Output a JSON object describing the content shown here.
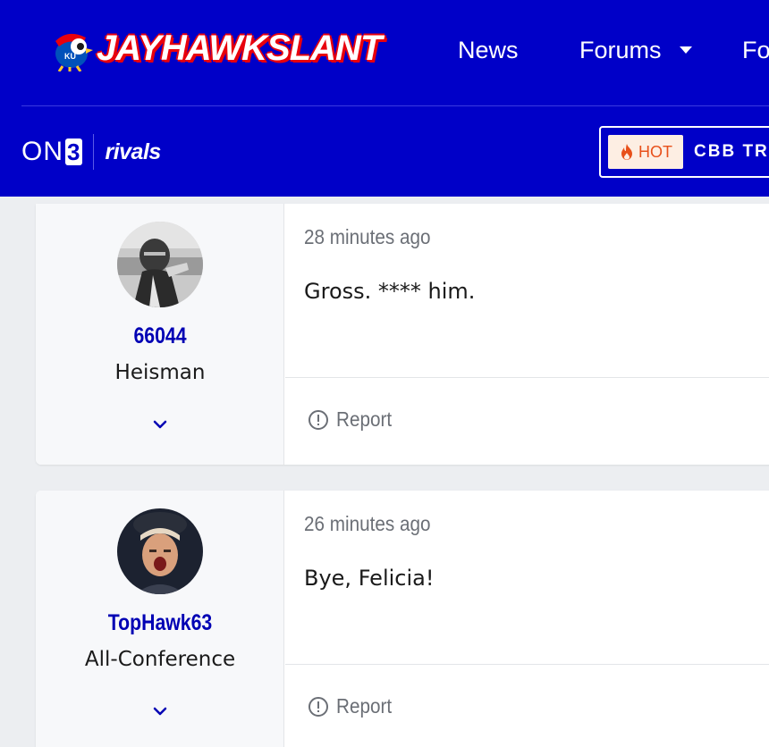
{
  "header": {
    "logo_text": "JAYHAWKSLANT",
    "nav": [
      {
        "label": "News"
      },
      {
        "label": "Forums"
      },
      {
        "label": "Fo"
      }
    ],
    "network": {
      "on": "ON",
      "three": "3",
      "rivals": "rivals"
    },
    "trending": {
      "hot_label": "HOT",
      "text": "CBB TR"
    },
    "colors": {
      "brand_blue": "#0000c8",
      "accent_red": "#e8000d",
      "hot_orange": "#e8501a"
    }
  },
  "posts": [
    {
      "time": "28 minutes ago",
      "body": "Gross. **** him.",
      "author": {
        "username": "66044",
        "rank": "Heisman"
      },
      "report_label": "Report"
    },
    {
      "time": "26 minutes ago",
      "body": "Bye, Felicia!",
      "author": {
        "username": "TopHawk63",
        "rank": "All-Conference"
      },
      "report_label": "Report"
    }
  ]
}
